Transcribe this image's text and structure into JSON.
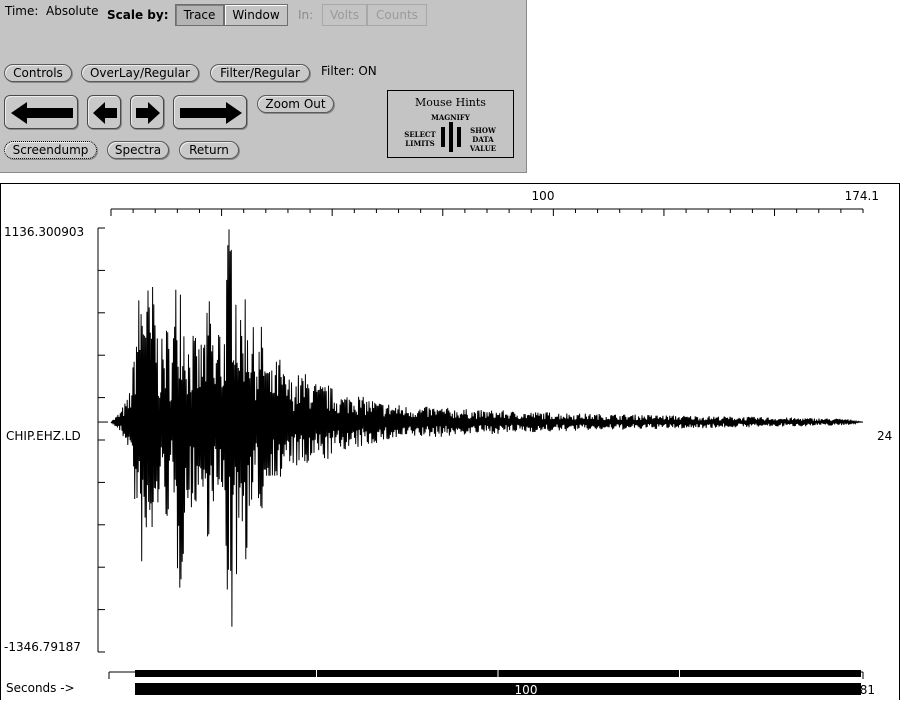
{
  "toolbar": {
    "time_label": "Time:",
    "time_value": "Absolute",
    "scale_by_label": "Scale by:",
    "scale_options": [
      "Trace",
      "Window"
    ],
    "units_label": "In:",
    "units_options": [
      "Volts",
      "Counts"
    ],
    "controls_label": "Controls",
    "overlay_label": "OverLay/Regular",
    "filter_label": "Filter/Regular",
    "filter_status": "Filter: ON",
    "zoom_out_label": "Zoom Out",
    "screendump_label": "Screendump",
    "spectra_label": "Spectra",
    "return_label": "Return"
  },
  "mouse_hints": {
    "title": "Mouse Hints",
    "middle": "MAGNIFY",
    "left_line1": "SELECT",
    "left_line2": "LIMITS",
    "right_line1": "SHOW",
    "right_line2": "DATA",
    "right_line3": "VALUE"
  },
  "plot": {
    "station": "CHIP.EHZ.LD",
    "channel_number": "24",
    "y_max_label": "1136.300903",
    "y_min_label": "-1346.79187",
    "top_axis": {
      "mid_label": "100",
      "end_label": "174.1"
    },
    "bottom_axis": {
      "prefix": "Seconds ->",
      "mid_label": "100",
      "end_label": "181"
    }
  },
  "chart_data": {
    "type": "line",
    "title": "",
    "xlabel": "Seconds ->",
    "ylabel": "",
    "ylim": [
      -1346.79187,
      1136.300903
    ],
    "xlim_top": [
      0,
      174.1
    ],
    "xlim_bottom": [
      0,
      181
    ],
    "series": [
      {
        "name": "CHIP.EHZ.LD",
        "x": [
          0,
          2,
          4,
          5,
          6,
          7,
          8,
          9,
          10,
          11,
          12,
          13,
          14,
          15,
          16,
          17,
          18,
          19,
          20,
          21,
          22,
          23,
          24,
          25,
          26,
          27,
          28,
          29,
          30,
          31,
          32,
          33,
          34,
          35,
          36,
          37,
          38,
          39,
          40,
          42,
          44,
          46,
          48,
          50,
          52,
          54,
          56,
          58,
          60,
          62,
          65,
          70,
          75,
          80,
          85,
          90,
          95,
          100,
          110,
          120,
          130,
          140,
          150,
          160,
          170,
          174.1
        ],
        "y": [
          0,
          60,
          -150,
          300,
          -700,
          850,
          -1000,
          700,
          -900,
          450,
          -500,
          600,
          -400,
          850,
          -1050,
          700,
          -500,
          550,
          -450,
          500,
          -600,
          800,
          -350,
          650,
          -450,
          1100,
          -1300,
          950,
          -600,
          850,
          -700,
          550,
          -450,
          600,
          -400,
          300,
          -350,
          400,
          -300,
          250,
          -300,
          280,
          -220,
          230,
          -180,
          160,
          -190,
          150,
          -140,
          120,
          -110,
          90,
          -90,
          80,
          -70,
          70,
          -60,
          60,
          -50,
          45,
          -40,
          35,
          -30,
          25,
          -20,
          0
        ]
      }
    ]
  }
}
